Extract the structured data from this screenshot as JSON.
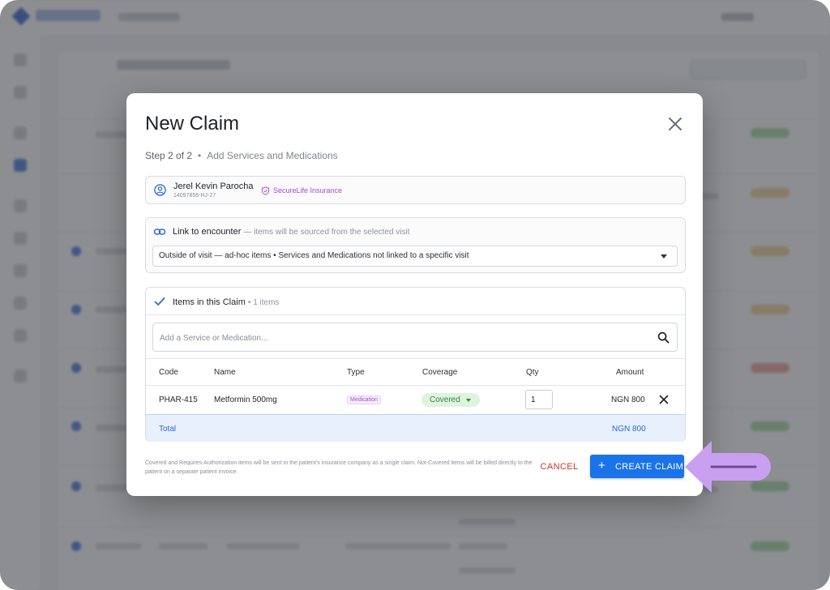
{
  "modal": {
    "title": "New Claim",
    "step": "Step 2 of 2",
    "step_separator": "•",
    "step_title": "Add Services and Medications"
  },
  "patient": {
    "name": "Jerel Kevin Parocha",
    "id": "14097856-HJ-27",
    "insurance": "SecureLife Insurance"
  },
  "encounter": {
    "label": "Link to encounter",
    "hint": "— items will be sourced from the selected visit",
    "selected_value": "Outside of visit — ad-hoc items  •  Services and Medications not linked to a specific visit"
  },
  "items": {
    "title": "Items in this Claim",
    "count_label": "• 1 items",
    "search_placeholder": "Add a Service or Medication...",
    "columns": {
      "code": "Code",
      "name": "Name",
      "type": "Type",
      "coverage": "Coverage",
      "qty": "Qty",
      "amount": "Amount"
    },
    "rows": [
      {
        "code": "PHAR-415",
        "name": "Metformin 500mg",
        "type": "Medication",
        "coverage": "Covered",
        "qty": "1",
        "amount": "NGN 800"
      }
    ],
    "total_label": "Total",
    "total_amount": "NGN 800"
  },
  "footer": {
    "note": "Covered and Requires-Authorization items will be sent to the patient's insurance company as a single claim. Not-Covered items will be billed directly to the patient on a separate patient invoice.",
    "cancel_label": "CANCEL",
    "create_label": "CREATE CLAIM",
    "create_icon": "+"
  },
  "colors": {
    "primary": "#1a73e8",
    "danger": "#d93025",
    "insurance": "#a24ad6",
    "covered": "#2f8a3a",
    "annotation_arrow": "#c9a0f0"
  }
}
